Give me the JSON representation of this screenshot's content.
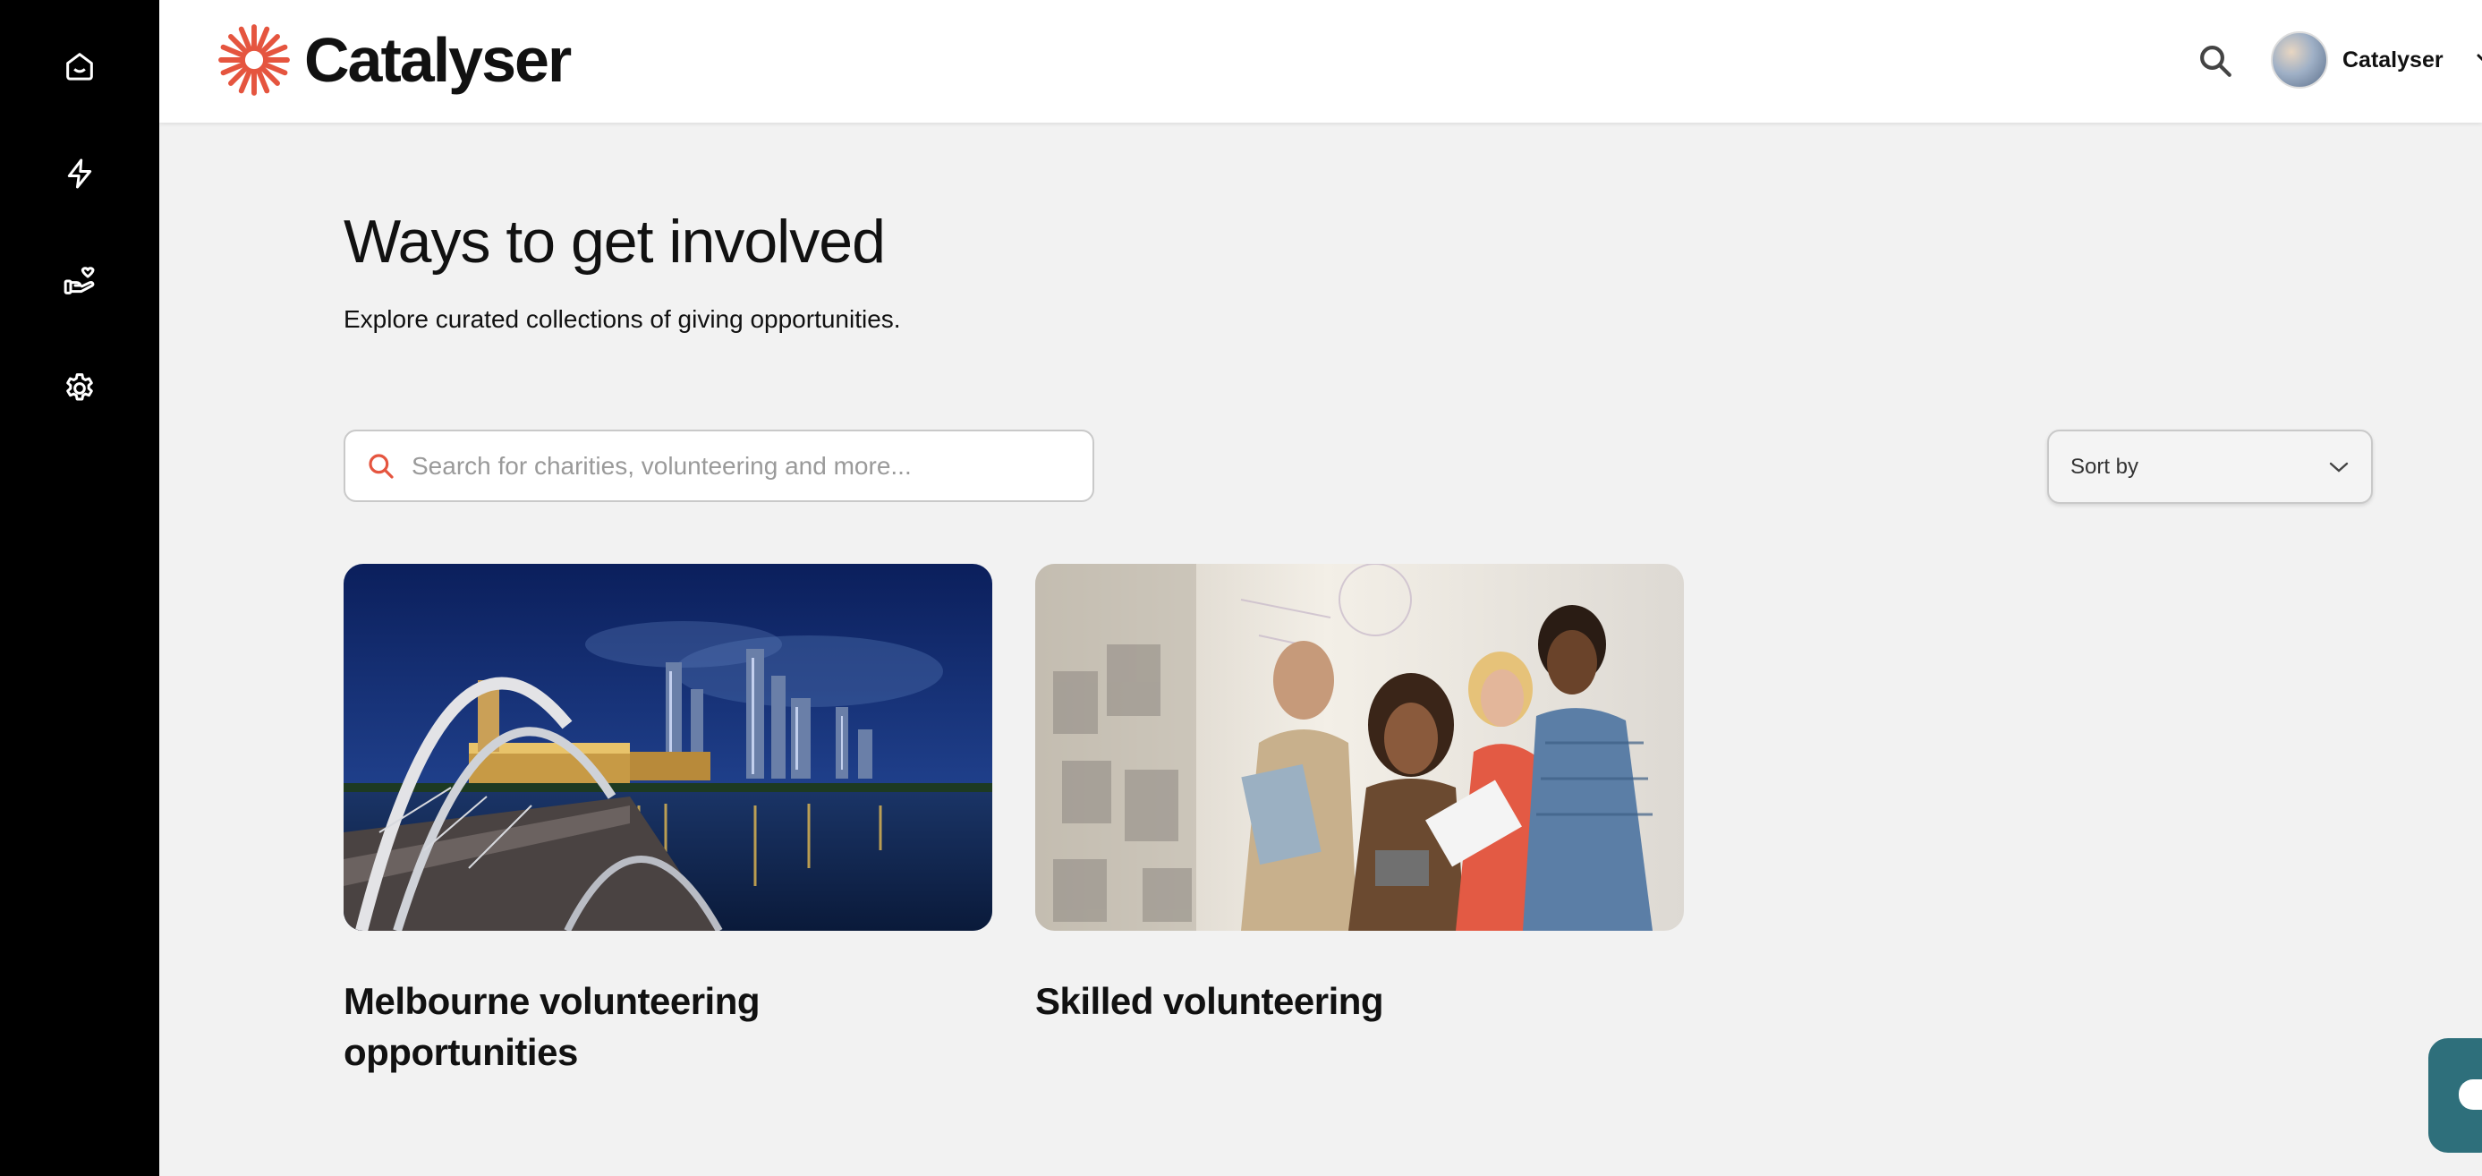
{
  "brand": {
    "name": "Catalyser",
    "accent_color": "#e5553f"
  },
  "sidebar": {
    "items": [
      {
        "icon": "home-icon"
      },
      {
        "icon": "lightning-icon"
      },
      {
        "icon": "hand-heart-icon"
      },
      {
        "icon": "gear-icon"
      }
    ]
  },
  "header": {
    "search_icon": "search-icon",
    "user": {
      "name": "Catalyser",
      "menu_icon": "chevron-down-icon"
    }
  },
  "main": {
    "title": "Ways to get involved",
    "subtitle": "Explore curated collections of giving opportunities.",
    "search": {
      "placeholder": "Search for charities, volunteering and more...",
      "value": ""
    },
    "sort": {
      "label": "Sort by"
    },
    "collections": [
      {
        "title": "Melbourne volunteering opportunities",
        "image": "melbourne-city-night-bridge"
      },
      {
        "title": "Skilled volunteering",
        "image": "people-brainstorming-whiteboard"
      }
    ]
  }
}
